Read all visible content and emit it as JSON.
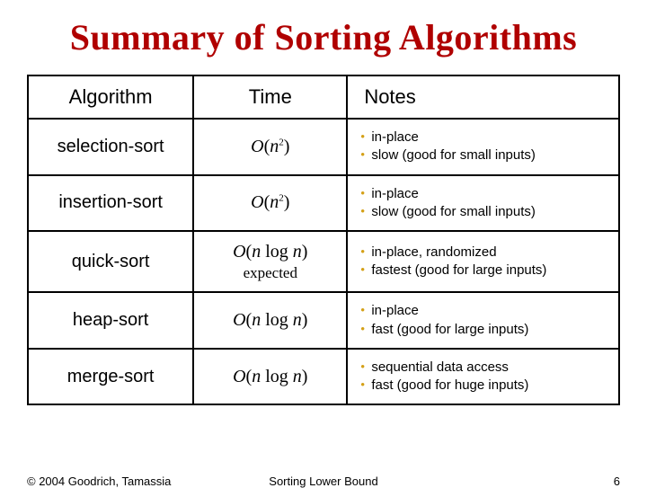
{
  "title": "Summary of Sorting Algorithms",
  "headers": {
    "algorithm": "Algorithm",
    "time": "Time",
    "notes": "Notes"
  },
  "rows": [
    {
      "algorithm": "selection-sort",
      "time_html": "<span class='ital'>O</span>(<span class='ital'>n</span><sup>2</sup>)",
      "notes": [
        "in-place",
        "slow (good for small inputs)"
      ]
    },
    {
      "algorithm": "insertion-sort",
      "time_html": "<span class='ital'>O</span>(<span class='ital'>n</span><sup>2</sup>)",
      "notes": [
        "in-place",
        "slow (good for small inputs)"
      ]
    },
    {
      "algorithm": "quick-sort",
      "time_html": "<span class='ital'>O</span>(<span class='ital'>n</span> log <span class='ital'>n</span>)<span class='sub'>expected</span>",
      "notes": [
        "in-place, randomized",
        "fastest (good for large inputs)"
      ]
    },
    {
      "algorithm": "heap-sort",
      "time_html": "<span class='ital'>O</span>(<span class='ital'>n</span> log <span class='ital'>n</span>)",
      "notes": [
        "in-place",
        "fast (good for large inputs)"
      ]
    },
    {
      "algorithm": "merge-sort",
      "time_html": "<span class='ital'>O</span>(<span class='ital'>n</span> log <span class='ital'>n</span>)",
      "notes": [
        "sequential data access",
        "fast  (good for huge inputs)"
      ]
    }
  ],
  "footer": {
    "copyright": "© 2004 Goodrich, Tamassia",
    "center": "Sorting Lower Bound",
    "page": "6"
  },
  "chart_data": {
    "type": "table",
    "title": "Summary of Sorting Algorithms",
    "columns": [
      "Algorithm",
      "Time",
      "Notes"
    ],
    "rows": [
      [
        "selection-sort",
        "O(n^2)",
        "in-place; slow (good for small inputs)"
      ],
      [
        "insertion-sort",
        "O(n^2)",
        "in-place; slow (good for small inputs)"
      ],
      [
        "quick-sort",
        "O(n log n) expected",
        "in-place, randomized; fastest (good for large inputs)"
      ],
      [
        "heap-sort",
        "O(n log n)",
        "in-place; fast (good for large inputs)"
      ],
      [
        "merge-sort",
        "O(n log n)",
        "sequential data access; fast (good for huge inputs)"
      ]
    ]
  }
}
